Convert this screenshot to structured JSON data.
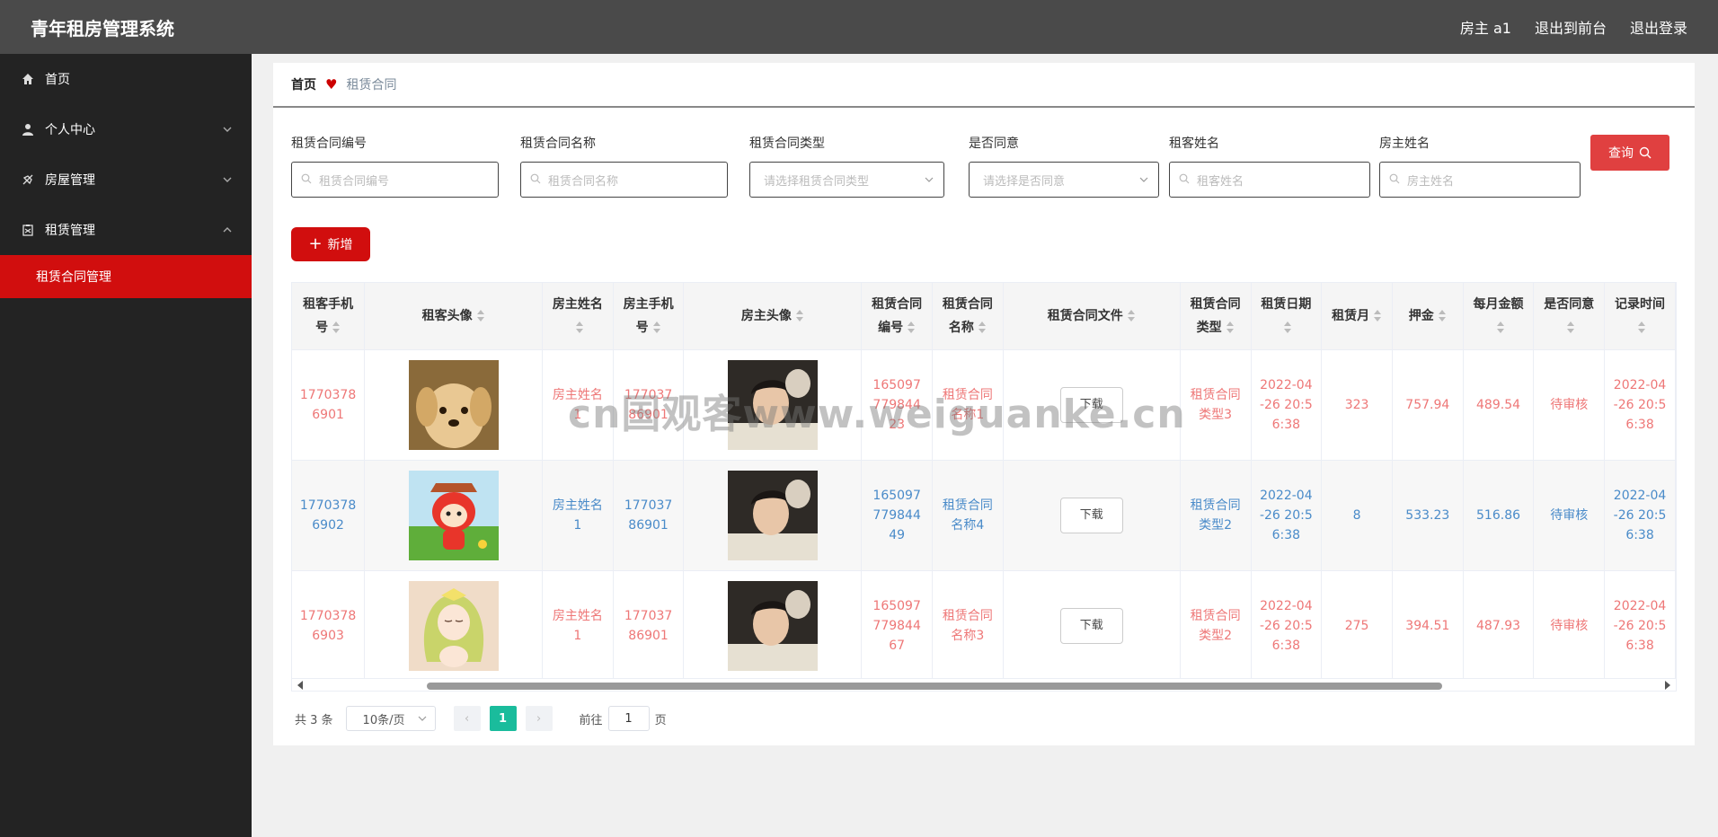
{
  "header": {
    "title": "青年租房管理系统",
    "user_label": "房主 a1",
    "goto_front": "退出到前台",
    "logout": "退出登录"
  },
  "sidebar": {
    "items": [
      {
        "label": "首页",
        "icon": "home-icon"
      },
      {
        "label": "个人中心",
        "icon": "user-icon"
      },
      {
        "label": "房屋管理",
        "icon": "house-icon"
      },
      {
        "label": "租赁管理",
        "icon": "clipboard-icon"
      }
    ],
    "active_sub": "租赁合同管理"
  },
  "breadcrumb": {
    "home": "首页",
    "current": "租赁合同"
  },
  "filters": [
    {
      "label": "租赁合同编号",
      "placeholder": "租赁合同编号",
      "type": "input"
    },
    {
      "label": "租赁合同名称",
      "placeholder": "租赁合同名称",
      "type": "input"
    },
    {
      "label": "租赁合同类型",
      "placeholder": "请选择租赁合同类型",
      "type": "select"
    },
    {
      "label": "是否同意",
      "placeholder": "请选择是否同意",
      "type": "select"
    },
    {
      "label": "租客姓名",
      "placeholder": "租客姓名",
      "type": "input"
    },
    {
      "label": "房主姓名",
      "placeholder": "房主姓名",
      "type": "input"
    }
  ],
  "buttons": {
    "search": "查询",
    "add": "新增",
    "download": "下载"
  },
  "table": {
    "headers": [
      "租客手机号",
      "租客头像",
      "房主姓名",
      "房主手机号",
      "房主头像",
      "租赁合同编号",
      "租赁合同名称",
      "租赁合同文件",
      "租赁合同类型",
      "租赁日期",
      "租赁月",
      "押金",
      "每月金额",
      "是否同意",
      "记录时间"
    ],
    "rows": [
      {
        "tenant_phone": "17703786901",
        "owner_name": "房主姓名1",
        "owner_phone": "17703786901",
        "contract_no": "16509777984423",
        "contract_name": "租赁合同名称1",
        "contract_type": "租赁合同类型3",
        "lease_date": "2022-04-26 20:56:38",
        "months": "323",
        "deposit": "757.94",
        "monthly": "489.54",
        "agree": "待审核",
        "record_time": "2022-04-26 20:56:38"
      },
      {
        "tenant_phone": "17703786902",
        "owner_name": "房主姓名1",
        "owner_phone": "17703786901",
        "contract_no": "16509777984449",
        "contract_name": "租赁合同名称4",
        "contract_type": "租赁合同类型2",
        "lease_date": "2022-04-26 20:56:38",
        "months": "8",
        "deposit": "533.23",
        "monthly": "516.86",
        "agree": "待审核",
        "record_time": "2022-04-26 20:56:38"
      },
      {
        "tenant_phone": "17703786903",
        "owner_name": "房主姓名1",
        "owner_phone": "17703786901",
        "contract_no": "16509777984467",
        "contract_name": "租赁合同名称3",
        "contract_type": "租赁合同类型2",
        "lease_date": "2022-04-26 20:56:38",
        "months": "275",
        "deposit": "394.51",
        "monthly": "487.93",
        "agree": "待审核",
        "record_time": "2022-04-26 20:56:38"
      }
    ]
  },
  "pagination": {
    "total": "共 3 条",
    "page_size": "10条/页",
    "current_page": "1",
    "goto_prefix": "前往",
    "goto_value": "1",
    "goto_suffix": "页"
  },
  "watermark": "cn国观客www.weiguanke.cn",
  "colors": {
    "topbar": "#4a4a4a",
    "sidebar": "#232323",
    "accent_red": "#d10e0e",
    "search_red": "#e04040",
    "row_red_text": "#ee7777",
    "row_blue_text": "#4a8bc9",
    "page_active": "#1abc9c"
  }
}
